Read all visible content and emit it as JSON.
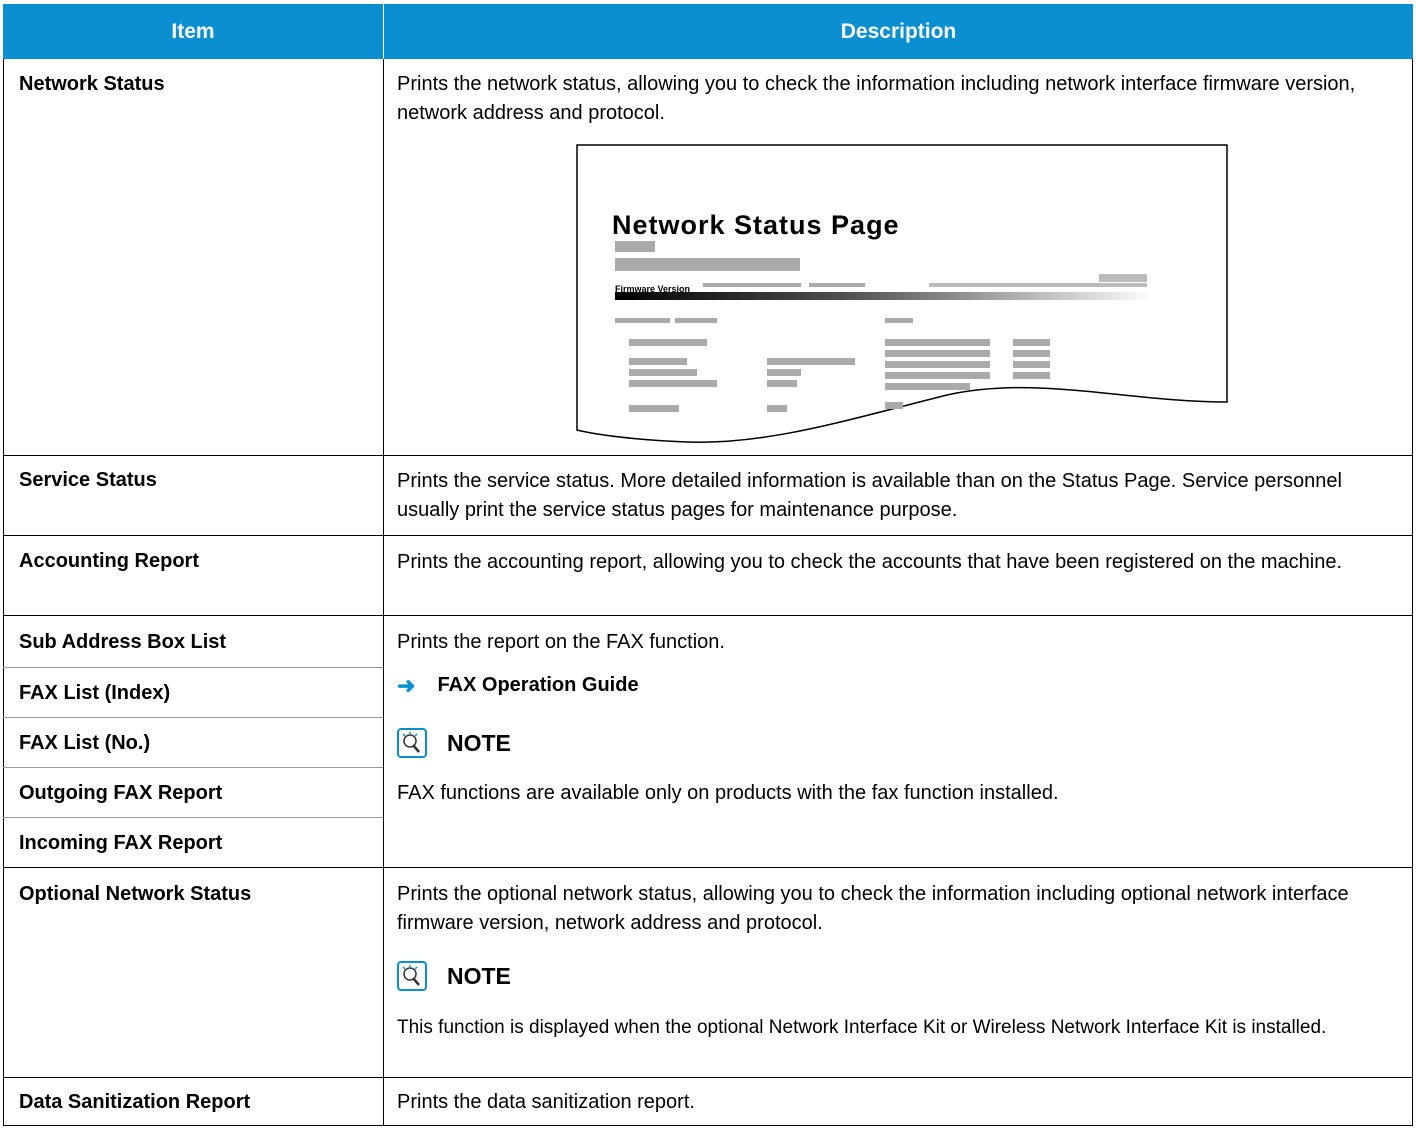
{
  "header": {
    "item": "Item",
    "description": "Description"
  },
  "rows": [
    {
      "item": "Network Status",
      "description": "Prints the network status, allowing you to check the information including network interface firmware version, network address and protocol."
    },
    {
      "item": "Service Status",
      "description": "Prints the service status. More detailed information is available than on the Status Page. Service personnel usually print the service status pages for maintenance purpose."
    },
    {
      "item": "Accounting Report",
      "description": "Prints the accounting report, allowing you to check the accounts that have been registered on the machine."
    },
    {
      "item": "Sub Address Box List",
      "description": "Prints the report on the FAX function."
    },
    {
      "item": "FAX List (Index)"
    },
    {
      "item": "FAX List (No.)"
    },
    {
      "item": "Outgoing FAX Report"
    },
    {
      "item": "Incoming FAX Report"
    },
    {
      "item": "Optional Network Status",
      "description": "Prints the optional network status, allowing you to check the information including optional network interface firmware version, network address and protocol."
    },
    {
      "item": "Data Sanitization Report",
      "description": "Prints the data sanitization report."
    }
  ],
  "fax_ref": "FAX Operation Guide",
  "note_label": "NOTE",
  "fax_note": "FAX functions are available only on products with the fax function installed.",
  "optional_note": "This function is displayed when the optional Network Interface Kit or Wireless Network Interface Kit is installed.",
  "report_sample": {
    "title": "Network Status Page",
    "firmware_label": "Firmware Version"
  },
  "colors": {
    "header_bg": "#0a8fd0",
    "accent": "#0a8fd0"
  },
  "icons": {
    "note": "note-lightbulb-icon",
    "reference": "reference-arrow-icon"
  }
}
